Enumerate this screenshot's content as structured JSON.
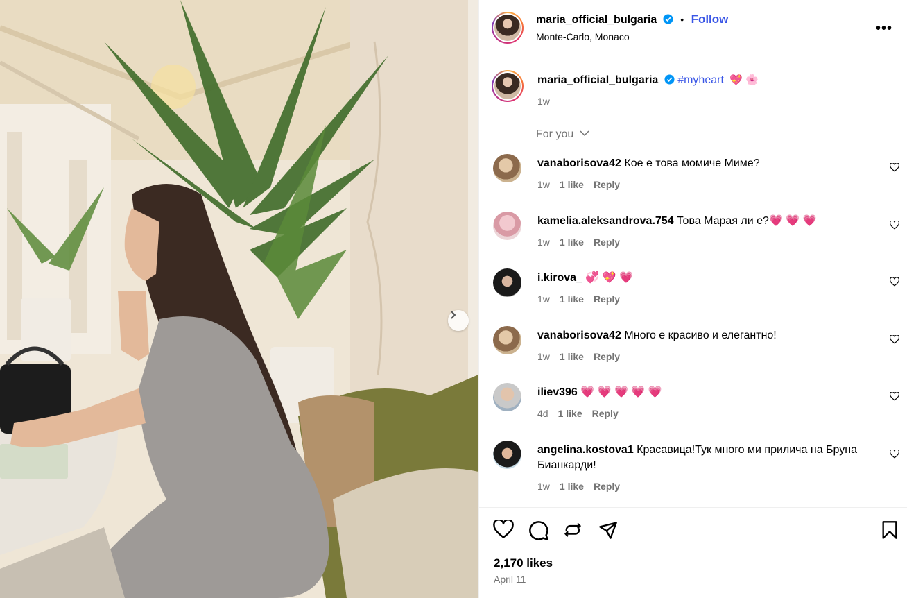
{
  "post": {
    "username": "maria_official_bulgaria",
    "follow_label": "Follow",
    "separator": "•",
    "location": "Monte-Carlo, Monaco",
    "more_label": "•••",
    "caption_hashtag": "#myheart",
    "caption_emoji": "💖 🌸",
    "caption_time": "1w"
  },
  "for_you_label": "For you",
  "comments": [
    {
      "user": "vanaborisova42",
      "text": "Кое е това момиче Миме?",
      "time": "1w",
      "likes": "1 like",
      "reply": "Reply"
    },
    {
      "user": "kamelia.aleksandrova.754",
      "text": "Това Марая ли е?💗 💗 💗",
      "time": "1w",
      "likes": "1 like",
      "reply": "Reply"
    },
    {
      "user": "i.kirova_",
      "text": "💞 💖 💗",
      "time": "1w",
      "likes": "1 like",
      "reply": "Reply"
    },
    {
      "user": "vanaborisova42",
      "text": "Много е красиво и елегантно!",
      "time": "1w",
      "likes": "1 like",
      "reply": "Reply"
    },
    {
      "user": "iliev396",
      "text": "💗 💗 💗 💗 💗",
      "time": "4d",
      "likes": "1 like",
      "reply": "Reply"
    },
    {
      "user": "angelina.kostova1",
      "text": "Красавица!Тук много ми прилича на Бруна Бианкарди!",
      "time": "1w",
      "likes": "1 like",
      "reply": "Reply"
    }
  ],
  "likes_label": "2,170 likes",
  "date_label": "April 11",
  "icons": {
    "like": "heart-icon",
    "comment": "comment-bubble-icon",
    "repost": "repost-icon",
    "share": "send-icon",
    "save": "bookmark-icon",
    "next": "chevron-right-icon",
    "verified": "verified-badge-icon"
  },
  "colors": {
    "link_blue": "#3a56e6",
    "verified_blue": "#0095f6",
    "muted_text": "#737373",
    "heart_pink": "#e8346b"
  }
}
